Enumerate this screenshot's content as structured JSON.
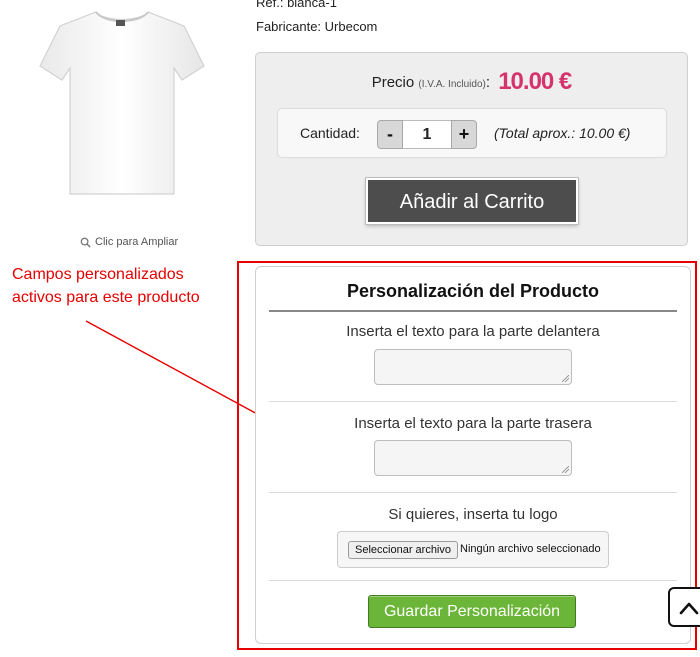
{
  "product": {
    "ref": "Ref.: blanca-1",
    "maker": "Fabricante: Urbecom",
    "zoom_label": "Clic para Ampliar",
    "image_icon": "white-tshirt"
  },
  "price": {
    "label": "Precio",
    "vat_note": "(I.V.A. Incluido)",
    "colon": ":",
    "amount": "10.00 €",
    "accent_color": "#d6336c"
  },
  "quantity": {
    "label": "Cantidad:",
    "minus": "-",
    "value": "1",
    "plus": "+",
    "total": "(Total aprox.: 10.00 €)"
  },
  "cart": {
    "add_label": "Añadir al Carrito"
  },
  "annotation": {
    "text": "Campos personalizados activos para este producto",
    "color": "#e60000"
  },
  "personalization": {
    "title": "Personalización del Producto",
    "front_label": "Inserta el texto para la parte delantera",
    "back_label": "Inserta el texto para la parte trasera",
    "logo_label": "Si quieres, inserta tu logo",
    "file_button": "Seleccionar archivo",
    "file_status": "Ningún archivo seleccionado",
    "save_label": "Guardar Personalización",
    "save_color": "#6bb638"
  },
  "scroll_top": {
    "icon": "chevron-up-icon"
  }
}
